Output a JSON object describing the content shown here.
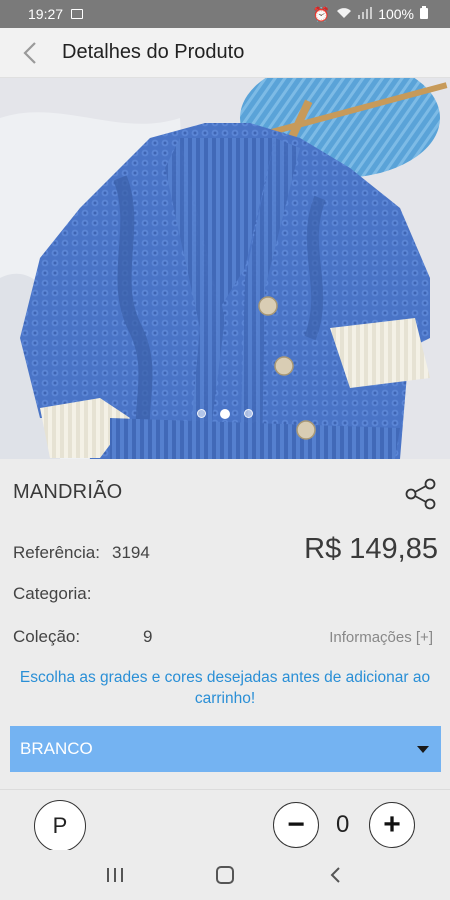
{
  "status_bar": {
    "time": "19:27",
    "battery": "100%"
  },
  "header": {
    "title": "Detalhes do Produto"
  },
  "gallery": {
    "slide_count": 3,
    "active_index": 1
  },
  "product": {
    "name": "MANDRIÃO",
    "ref_label": "Referência:",
    "ref_value": "3194",
    "price": "R$ 149,85",
    "category_label": "Categoria:",
    "collection_label": "Coleção:",
    "collection_value": "9",
    "more_info": "Informações [+]"
  },
  "notice": "Escolha as grades e cores desejadas antes de adicionar ao carrinho!",
  "color_select": {
    "selected": "BRANCO"
  },
  "sizes": [
    {
      "label": "P"
    }
  ],
  "quantity": {
    "value": "0",
    "minus": "−",
    "plus": "+"
  },
  "colors": {
    "accent": "#74b3f2",
    "notice": "#2a8fd6",
    "sweater": "#4a74c6"
  }
}
